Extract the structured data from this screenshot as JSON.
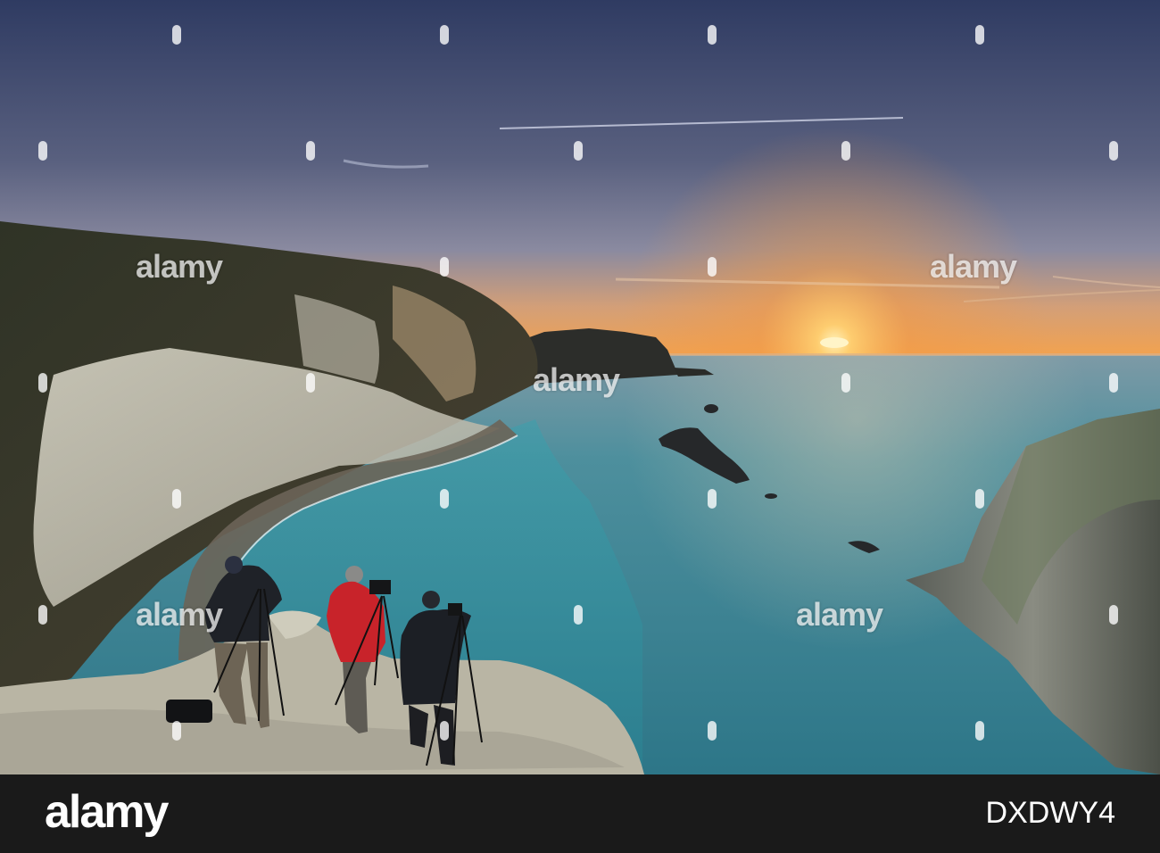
{
  "photo": {
    "subject": "photographers-on-clifftop-at-sunset",
    "colors": {
      "sky_top": "#3c4c74",
      "sky_mid": "#7a7f98",
      "horizon_glow": "#f4a04c",
      "sun": "#ffd58a",
      "sea": "#3f8f9c",
      "cliff_dark": "#3a3a2e",
      "chalk": "#c9c6b8"
    }
  },
  "watermark": {
    "text": "alamy"
  },
  "footer": {
    "logo": "alamy",
    "image_id": "DXDWY4"
  }
}
